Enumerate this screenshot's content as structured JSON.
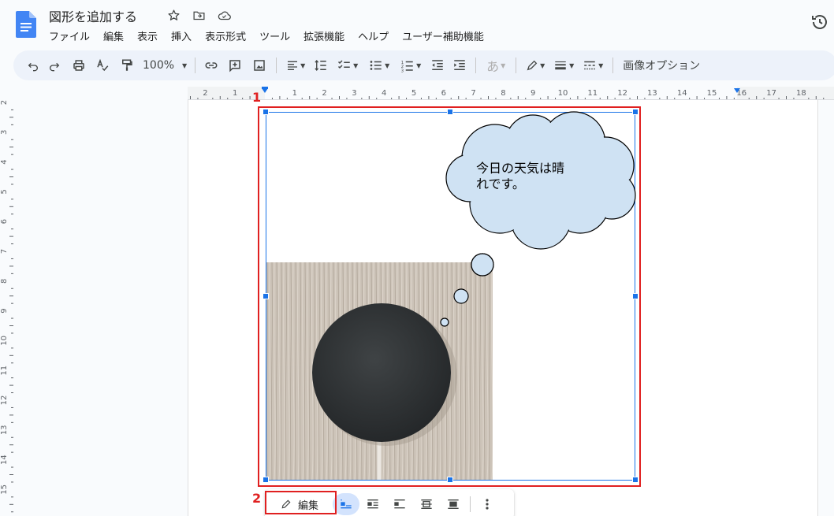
{
  "document": {
    "title": "図形を追加する"
  },
  "menu": {
    "items": [
      "ファイル",
      "編集",
      "表示",
      "挿入",
      "表示形式",
      "ツール",
      "拡張機能",
      "ヘルプ",
      "ユーザー補助機能"
    ]
  },
  "toolbar": {
    "zoom": "100%",
    "input_char": "あ",
    "image_options_label": "画像オプション"
  },
  "ruler": {
    "h_labels": [
      "2",
      "1",
      "1",
      "2",
      "3",
      "4",
      "5",
      "6",
      "7",
      "8",
      "9",
      "10",
      "11",
      "12",
      "13",
      "14",
      "15",
      "16",
      "17",
      "18"
    ],
    "v_labels": [
      "2",
      "3",
      "4",
      "5",
      "6",
      "7",
      "8",
      "9",
      "10",
      "11",
      "12",
      "13",
      "14",
      "15"
    ]
  },
  "drawing": {
    "bubble_text_line1": "今日の天気は晴",
    "bubble_text_line2": "れです。",
    "cloud_fill": "#cfe2f3"
  },
  "annotations": {
    "label1": "1",
    "label2": "2",
    "highlight_color": "#e02020"
  },
  "image_toolbar": {
    "edit_label": "編集"
  }
}
